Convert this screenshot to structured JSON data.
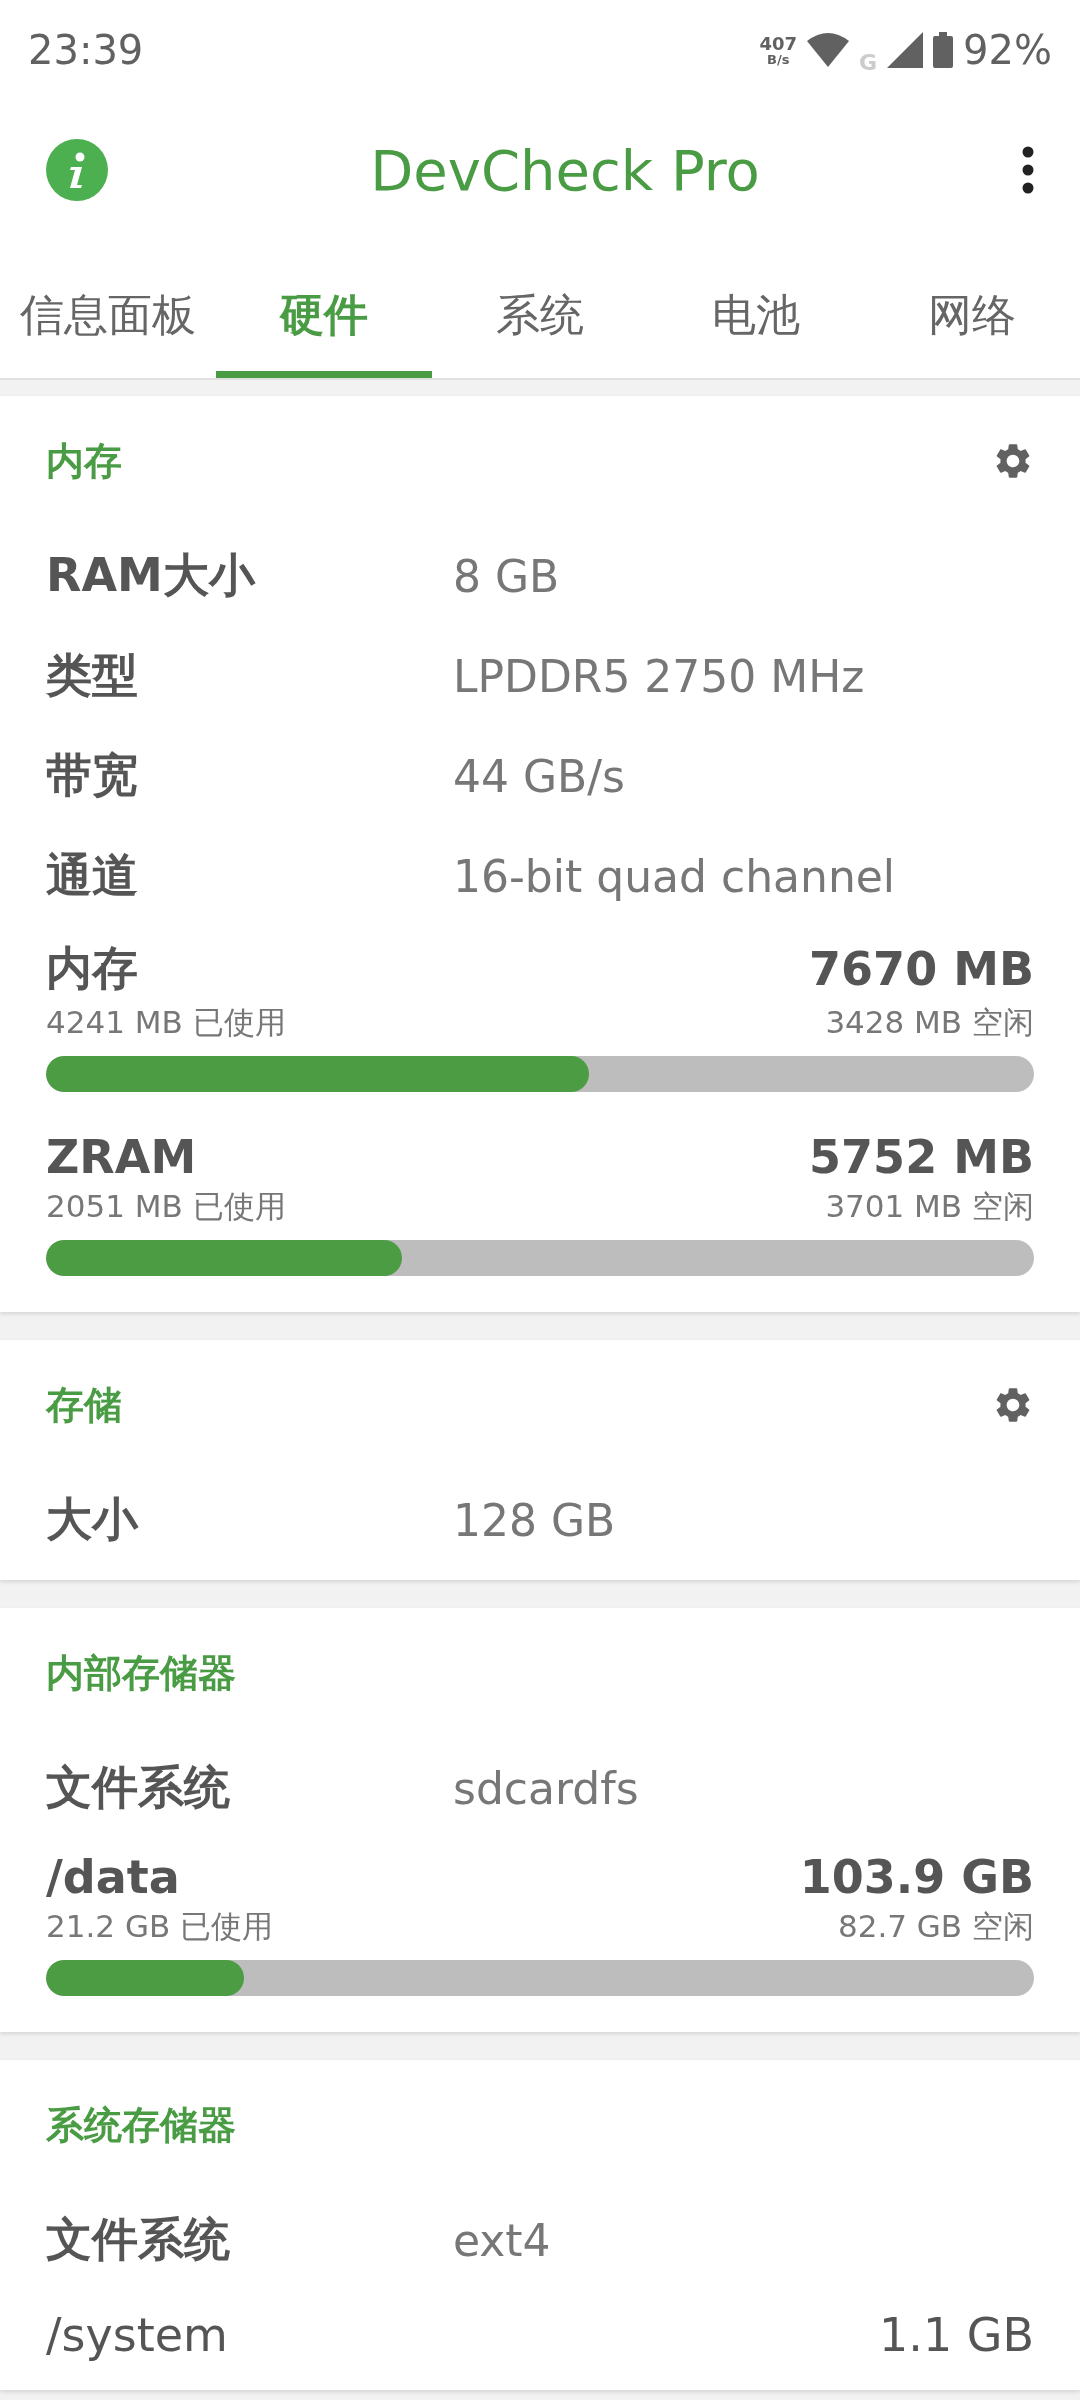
{
  "status_bar": {
    "time": "23:39",
    "net_speed": "407",
    "net_unit": "B/s",
    "network": "G",
    "battery": "92%"
  },
  "app_bar": {
    "title": "DevCheck Pro"
  },
  "tabs": [
    {
      "label": "信息面板",
      "selected": false
    },
    {
      "label": "硬件",
      "selected": true
    },
    {
      "label": "系统",
      "selected": false
    },
    {
      "label": "电池",
      "selected": false
    },
    {
      "label": "网络",
      "selected": false
    }
  ],
  "cards": [
    {
      "title": "内存",
      "has_settings": true,
      "rows": [
        {
          "kind": "pair",
          "label": "RAM大小",
          "value": "8 GB"
        },
        {
          "kind": "pair",
          "label": "类型",
          "value": "LPDDR5 2750 MHz"
        },
        {
          "kind": "pair",
          "label": "带宽",
          "value": "44 GB/s"
        },
        {
          "kind": "pair",
          "label": "通道",
          "value": "16-bit quad channel"
        },
        {
          "kind": "usage",
          "label": "内存",
          "total": "7670 MB",
          "used": "4241 MB 已使用",
          "free": "3428 MB 空闲",
          "level": 0.55
        },
        {
          "kind": "usage",
          "label": "ZRAM",
          "total": "5752 MB",
          "used": "2051 MB 已使用",
          "free": "3701 MB 空闲",
          "level": 0.36
        }
      ]
    },
    {
      "title": "存储",
      "has_settings": true,
      "rows": [
        {
          "kind": "pair",
          "label": "大小",
          "value": "128 GB"
        }
      ]
    },
    {
      "title": "内部存储器",
      "has_settings": false,
      "rows": [
        {
          "kind": "pair",
          "label": "文件系统",
          "value": "sdcardfs"
        },
        {
          "kind": "usage",
          "label": "/data",
          "total": "103.9 GB",
          "used": "21.2 GB 已使用",
          "free": "82.7 GB 空闲",
          "level": 0.2
        }
      ]
    },
    {
      "title": "系统存储器",
      "has_settings": false,
      "rows": [
        {
          "kind": "pair",
          "label": "文件系统",
          "value": "ext4"
        },
        {
          "kind": "total",
          "label": "/system",
          "total": "1.1 GB"
        }
      ]
    }
  ]
}
